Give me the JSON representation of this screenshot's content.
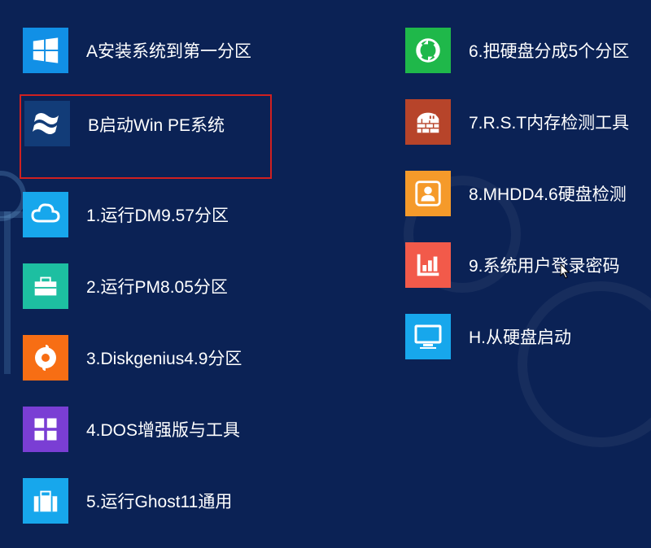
{
  "colors": {
    "bg": "#0b2255",
    "selectBorder": "#d02020",
    "blue": "#1190e6",
    "darkBlue": "#123c78",
    "teal": "#1dbfa1",
    "orange": "#f76e14",
    "purple": "#7a3ed4",
    "cyan": "#17a7ec",
    "green": "#1fb84a",
    "brown": "#b7442a",
    "orangeSoft": "#f59a2a",
    "coral": "#f25a4a"
  },
  "left": [
    {
      "icon": "windows8",
      "tile": "#1190e6",
      "label": "A安装系统到第一分区",
      "selected": false
    },
    {
      "icon": "windowsFlag",
      "tile": "#123c78",
      "label": "B启动Win PE系统",
      "selected": true
    },
    {
      "icon": "cloud",
      "tile": "#17a7ec",
      "label": "1.运行DM9.57分区"
    },
    {
      "icon": "briefcase",
      "tile": "#1dbfa1",
      "label": "2.运行PM8.05分区"
    },
    {
      "icon": "origin",
      "tile": "#f76e14",
      "label": "3.Diskgenius4.9分区"
    },
    {
      "icon": "tiles",
      "tile": "#7a3ed4",
      "label": "4.DOS增强版与工具"
    },
    {
      "icon": "suitcase",
      "tile": "#17a7ec",
      "label": "5.运行Ghost11通用"
    }
  ],
  "right": [
    {
      "icon": "sync",
      "tile": "#1fb84a",
      "label": "6.把硬盘分成5个分区"
    },
    {
      "icon": "firewall",
      "tile": "#b7442a",
      "label": "7.R.S.T内存检测工具"
    },
    {
      "icon": "person",
      "tile": "#f59a2a",
      "label": "8.MHDD4.6硬盘检测"
    },
    {
      "icon": "chart",
      "tile": "#f25a4a",
      "label": "9.系统用户登录密码"
    },
    {
      "icon": "monitor",
      "tile": "#17a7ec",
      "label": "H.从硬盘启动"
    }
  ]
}
